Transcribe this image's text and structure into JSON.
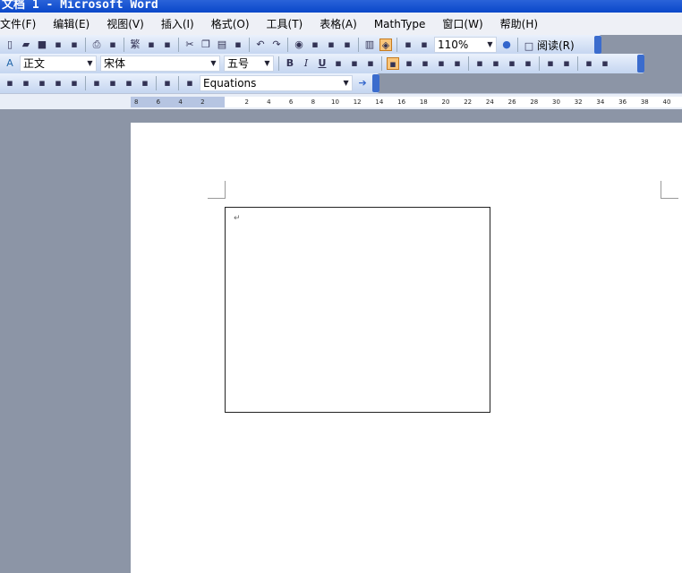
{
  "title": "文档 1 - Microsoft Word",
  "menu": [
    "文件(F)",
    "编辑(E)",
    "视图(V)",
    "插入(I)",
    "格式(O)",
    "工具(T)",
    "表格(A)",
    "MathType",
    "窗口(W)",
    "帮助(H)"
  ],
  "standard_toolbar": {
    "zoom": "110%",
    "read_label": "阅读(R)",
    "icons": [
      "new-icon",
      "open-icon",
      "save-icon",
      "permission-icon",
      "email-icon",
      "print-icon",
      "print-preview-icon",
      "traditional-chinese-icon",
      "research-icon",
      "spelling-icon",
      "cut-icon",
      "copy-icon",
      "paste-icon",
      "format-painter-icon",
      "undo-icon",
      "redo-icon",
      "hyperlink-icon",
      "tables-borders-icon",
      "insert-table-icon",
      "insert-excel-icon",
      "columns-icon",
      "drawing-icon",
      "document-map-icon",
      "show-hide-icon",
      "help-icon"
    ]
  },
  "formatting_toolbar": {
    "style": "正文",
    "font": "宋体",
    "size": "五号",
    "bold": "B",
    "italic": "I",
    "underline": "U"
  },
  "mathtype_toolbar": {
    "equations": "Equations"
  },
  "ruler": {
    "left_labels": [
      "8",
      "6",
      "4",
      "2"
    ],
    "right_labels": [
      "2",
      "4",
      "6",
      "8",
      "10",
      "12",
      "14",
      "16",
      "18",
      "20",
      "22",
      "24",
      "26",
      "28",
      "30",
      "32",
      "34",
      "36",
      "38",
      "40"
    ]
  },
  "document": {
    "paragraph_mark": "↵"
  }
}
